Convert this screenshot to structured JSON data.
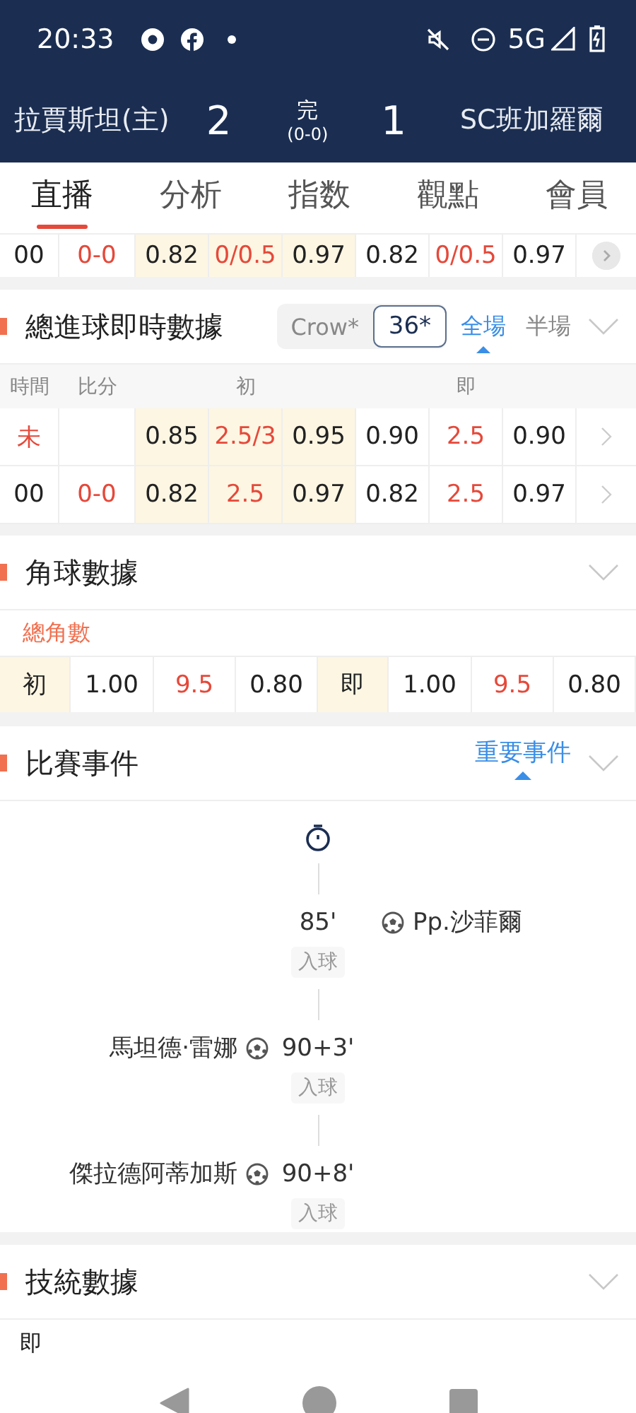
{
  "status_bar": {
    "time": "20:33",
    "network": "5G"
  },
  "match": {
    "home": "拉賈斯坦(主)",
    "home_score": "2",
    "status": "完",
    "half_score": "(0-0)",
    "away_score": "1",
    "away": "SC班加羅爾"
  },
  "tabs": [
    {
      "label": "直播",
      "selected": true
    },
    {
      "label": "分析",
      "selected": false
    },
    {
      "label": "指数",
      "selected": false
    },
    {
      "label": "觀點",
      "selected": false
    },
    {
      "label": "會員",
      "selected": false
    }
  ],
  "handicap_row": {
    "time": "00",
    "kind": "played",
    "score": "0-0",
    "initial": [
      "0.82",
      "0/0.5",
      "0.97"
    ],
    "live": [
      "0.82",
      "0/0.5",
      "0.97"
    ]
  },
  "total_goals": {
    "title": "總進球即時數據",
    "company": "Crow*",
    "company_field": "36*",
    "periods": [
      {
        "label": "全場",
        "selected": true
      },
      {
        "label": "半場",
        "selected": false
      }
    ],
    "columns": [
      "時間",
      "比分",
      "初",
      "即"
    ],
    "rows": [
      {
        "time": "未",
        "kind": "pending",
        "score": "",
        "initial": [
          "0.85",
          "2.5/3",
          "0.95"
        ],
        "live": [
          "0.90",
          "2.5",
          "0.90"
        ]
      },
      {
        "time": "00",
        "kind": "played",
        "score": "0-0",
        "initial": [
          "0.82",
          "2.5",
          "0.97"
        ],
        "live": [
          "0.82",
          "2.5",
          "0.97"
        ]
      }
    ]
  },
  "corners": {
    "title": "角球數據",
    "subtitle": "總角數",
    "cells": [
      {
        "text": "初",
        "kind": "label"
      },
      {
        "text": "1.00",
        "kind": "odds"
      },
      {
        "text": "9.5",
        "kind": "line"
      },
      {
        "text": "0.80",
        "kind": "odds"
      },
      {
        "text": "即",
        "kind": "label"
      },
      {
        "text": "1.00",
        "kind": "odds"
      },
      {
        "text": "9.5",
        "kind": "line"
      },
      {
        "text": "0.80",
        "kind": "odds"
      }
    ]
  },
  "events": {
    "title": "比賽事件",
    "filter": "重要事件",
    "items": [
      {
        "minute": "85'",
        "away_player": "Pp.沙菲爾",
        "type": "入球"
      },
      {
        "home_player": "馬坦德·雷娜",
        "minute": "90+3'",
        "type": "入球"
      },
      {
        "home_player": "傑拉德阿蒂加斯",
        "minute": "90+8'",
        "type": "入球"
      }
    ]
  },
  "tech_stats": {
    "title": "技統數據",
    "label": "即"
  }
}
